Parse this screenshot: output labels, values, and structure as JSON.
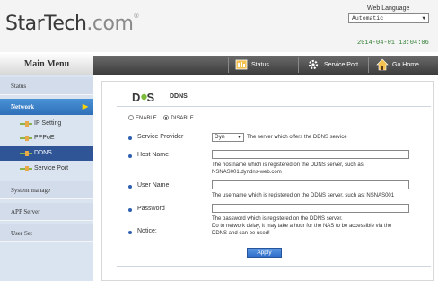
{
  "header": {
    "logo_dark": "StarTech",
    "logo_light": ".com",
    "logo_mark": "®",
    "language_label": "Web Language",
    "language_value": "Automatic",
    "datetime": "2014-04-01 13:04:06"
  },
  "sidebar": {
    "title": "Main Menu",
    "items": [
      {
        "label": "Status"
      },
      {
        "label": "Network"
      },
      {
        "label": "IP Setting"
      },
      {
        "label": "PPPoE"
      },
      {
        "label": "DDNS"
      },
      {
        "label": "Service Port"
      },
      {
        "label": "System manage"
      },
      {
        "label": "APP Server"
      },
      {
        "label": "User Set"
      }
    ]
  },
  "toolbar": {
    "status": "Status",
    "service_port": "Service Port",
    "go_home": "Go Home"
  },
  "ddns": {
    "title": "DDNS",
    "logo_text": "DNS",
    "enable_label": "ENABLE",
    "disable_label": "DISABLE",
    "selected": "DISABLE",
    "service_provider_label": "Service Provider",
    "service_provider_value": "Dyn",
    "service_provider_hint": "The server which offers the DDNS service",
    "host_name_label": "Host Name",
    "host_name_value": "",
    "host_name_hint_1": "The hostname which is registered on the DDNS server, such as:",
    "host_name_hint_2": "NSNAS001.dyndns-web.com",
    "user_name_label": "User Name",
    "user_name_value": "",
    "user_name_hint": "The username which is registered on the DDNS server. such as: NSNAS001",
    "password_label": "Password",
    "password_value": "",
    "password_hint": "The password which is registered on the DDNS server.",
    "notice_label": "Notice:",
    "notice_1": "Do to network delay, it may take a hour for the NAS to be accessible via the",
    "notice_2": "DDNS and can be used!",
    "apply_label": "Apply"
  },
  "colors": {
    "accent": "#2f6fb8",
    "active_sub": "#2f5597",
    "datetime": "#2e7d32",
    "sidebar_bg": "#d9e4f0"
  }
}
